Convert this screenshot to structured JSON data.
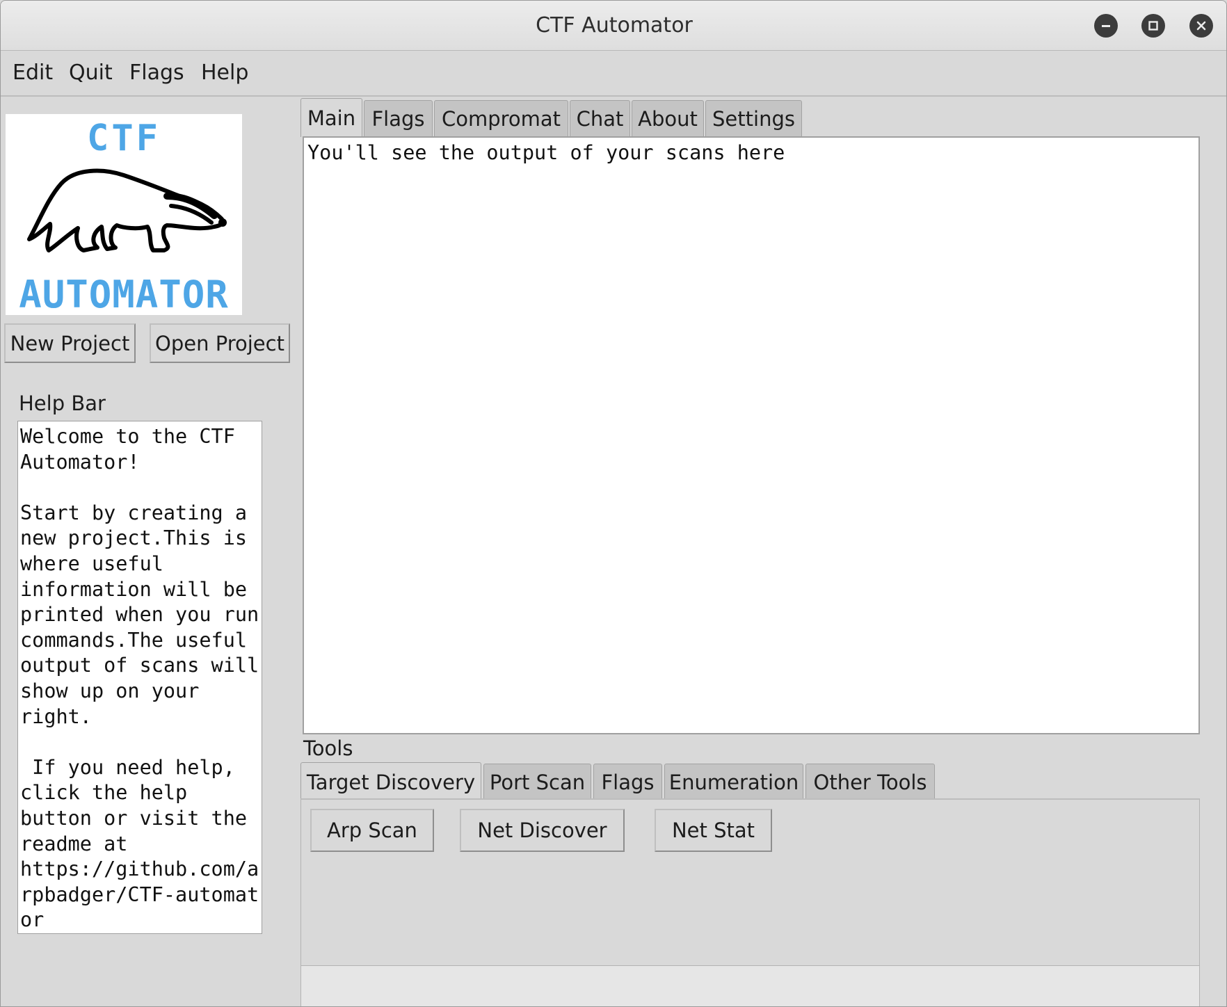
{
  "window": {
    "title": "CTF Automator",
    "controls": [
      "minimize-icon",
      "maximize-icon",
      "close-icon"
    ]
  },
  "menubar": {
    "items": [
      "Edit",
      "Quit",
      "Flags",
      "Help"
    ]
  },
  "logo": {
    "top_text": "CTF",
    "bottom_text": "AUTOMATOR",
    "accent_color": "#4ea6e6"
  },
  "project_buttons": {
    "new_project": "New Project",
    "open_project": "Open Project"
  },
  "helpbar": {
    "label": "Help Bar",
    "text": "Welcome to the CTF\nAutomator!\n\nStart by creating a\nnew project.This is\nwhere useful\ninformation will be\nprinted when you run\ncommands.The useful\noutput of scans will\nshow up on your\nright.\n\n If you need help,\nclick the help\nbutton or visit the\nreadme at\nhttps://github.com/a\nrpbadger/CTF-automat\nor"
  },
  "main_tabs": {
    "items": [
      "Main",
      "Flags",
      "Compromat",
      "Chat",
      "About",
      "Settings"
    ],
    "selected": "Main"
  },
  "output": {
    "text": "You'll see the output of your scans here"
  },
  "tools": {
    "label": "Tools",
    "tabs": [
      "Target Discovery",
      "Port Scan",
      "Flags",
      "Enumeration",
      "Other Tools"
    ],
    "selected": "Target Discovery",
    "buttons": [
      "Arp Scan",
      "Net Discover",
      "Net Stat"
    ]
  }
}
